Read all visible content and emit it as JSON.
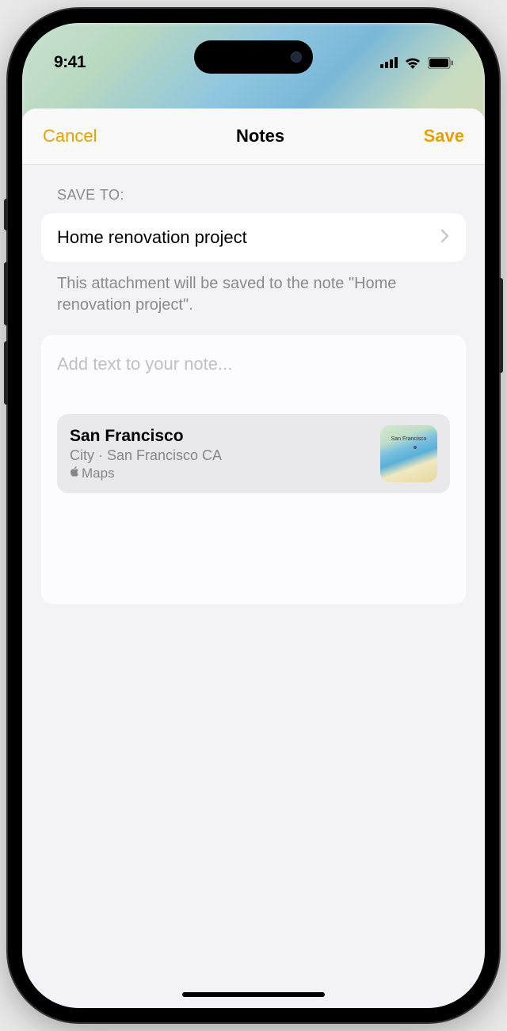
{
  "statusBar": {
    "time": "9:41"
  },
  "nav": {
    "cancel": "Cancel",
    "title": "Notes",
    "save": "Save"
  },
  "saveTo": {
    "label": "SAVE TO:",
    "noteName": "Home renovation project",
    "description": "This attachment will be saved to the note \"Home renovation project\"."
  },
  "noteArea": {
    "placeholder": "Add text to your note..."
  },
  "attachment": {
    "title": "San Francisco",
    "subtitle": "City · San Francisco CA",
    "app": "Maps",
    "thumbLabel": "San Francisco"
  }
}
